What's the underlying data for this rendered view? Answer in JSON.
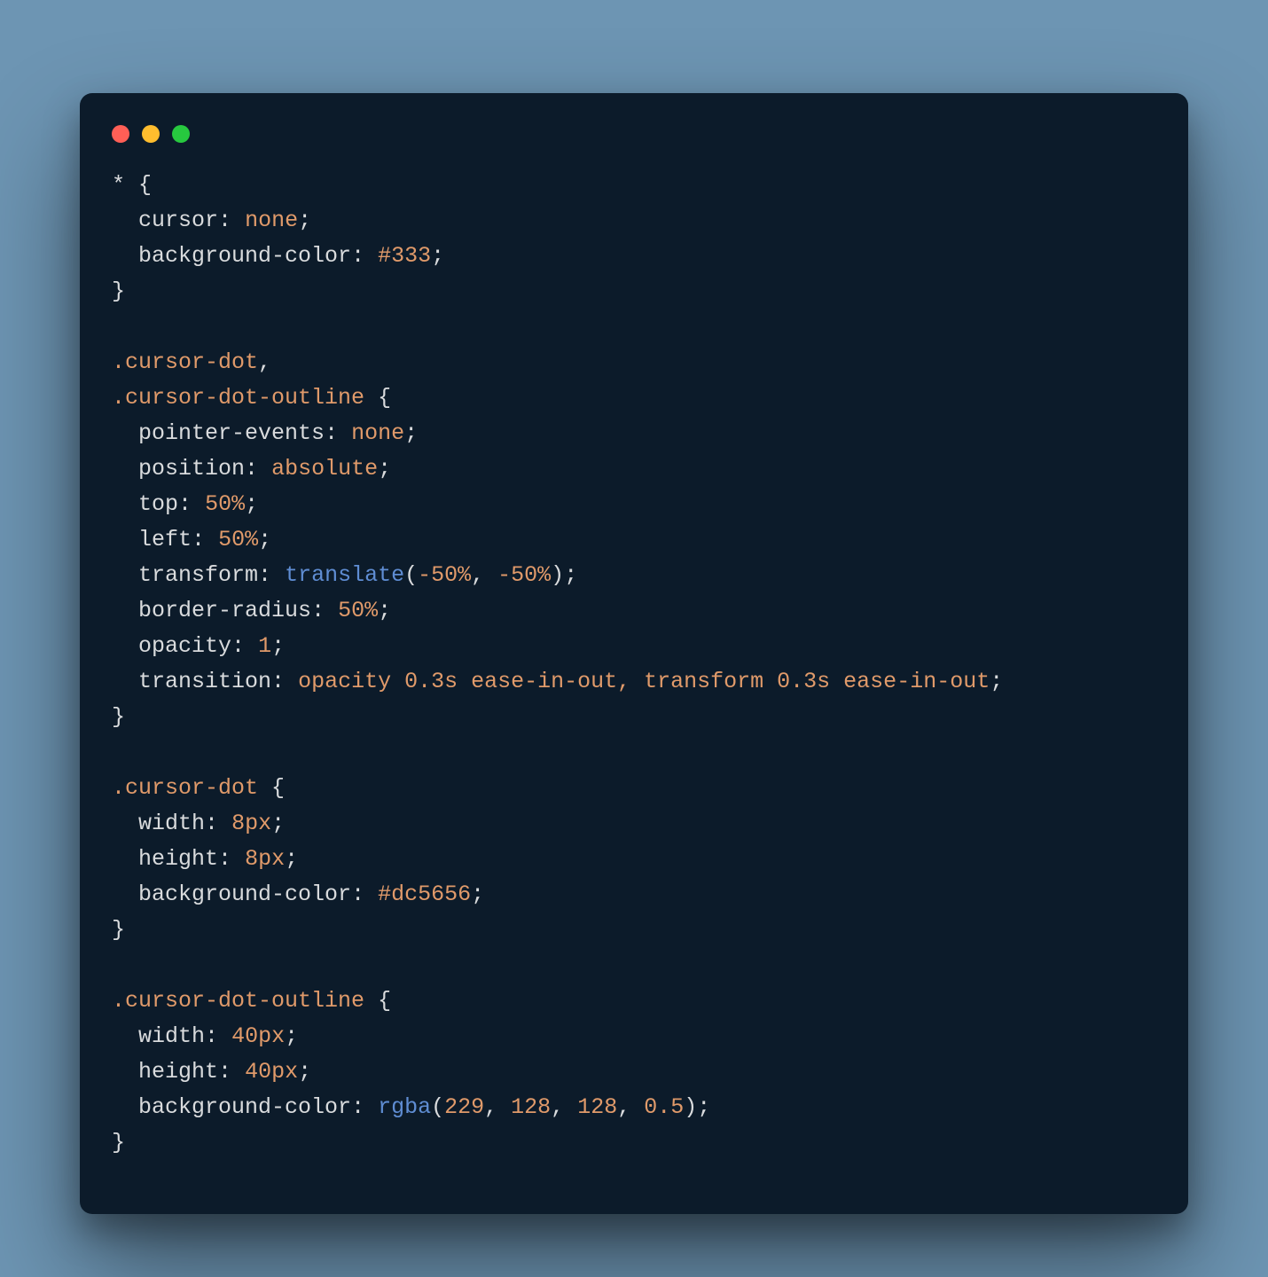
{
  "window": {
    "traffic_lights": [
      "close",
      "minimize",
      "zoom"
    ]
  },
  "code": {
    "rule1": {
      "selector": "*",
      "decls": [
        {
          "prop": "cursor",
          "value": "none"
        },
        {
          "prop": "background-color",
          "value": "#333"
        }
      ]
    },
    "rule2": {
      "selectorA": ".cursor-dot",
      "selectorB": ".cursor-dot-outline",
      "decls": [
        {
          "prop": "pointer-events",
          "value": "none"
        },
        {
          "prop": "position",
          "value": "absolute"
        },
        {
          "prop": "top",
          "value": "50%"
        },
        {
          "prop": "left",
          "value": "50%"
        },
        {
          "prop": "transform",
          "func": "translate",
          "args": [
            "-50%",
            "-50%"
          ]
        },
        {
          "prop": "border-radius",
          "value": "50%"
        },
        {
          "prop": "opacity",
          "value": "1"
        },
        {
          "prop": "transition",
          "value": "opacity 0.3s ease-in-out, transform 0.3s ease-in-out"
        }
      ]
    },
    "rule3": {
      "selector": ".cursor-dot",
      "decls": [
        {
          "prop": "width",
          "value": "8px"
        },
        {
          "prop": "height",
          "value": "8px"
        },
        {
          "prop": "background-color",
          "value": "#dc5656"
        }
      ]
    },
    "rule4": {
      "selector": ".cursor-dot-outline",
      "decls": [
        {
          "prop": "width",
          "value": "40px"
        },
        {
          "prop": "height",
          "value": "40px"
        },
        {
          "prop": "background-color",
          "func": "rgba",
          "args": [
            "229",
            "128",
            "128",
            "0.5"
          ]
        }
      ]
    }
  },
  "syntax": {
    "open_brace": "{",
    "close_brace": "}",
    "colon": ":",
    "semicolon": ";",
    "comma": ",",
    "open_paren": "(",
    "close_paren": ")",
    "comma_space": ", "
  }
}
